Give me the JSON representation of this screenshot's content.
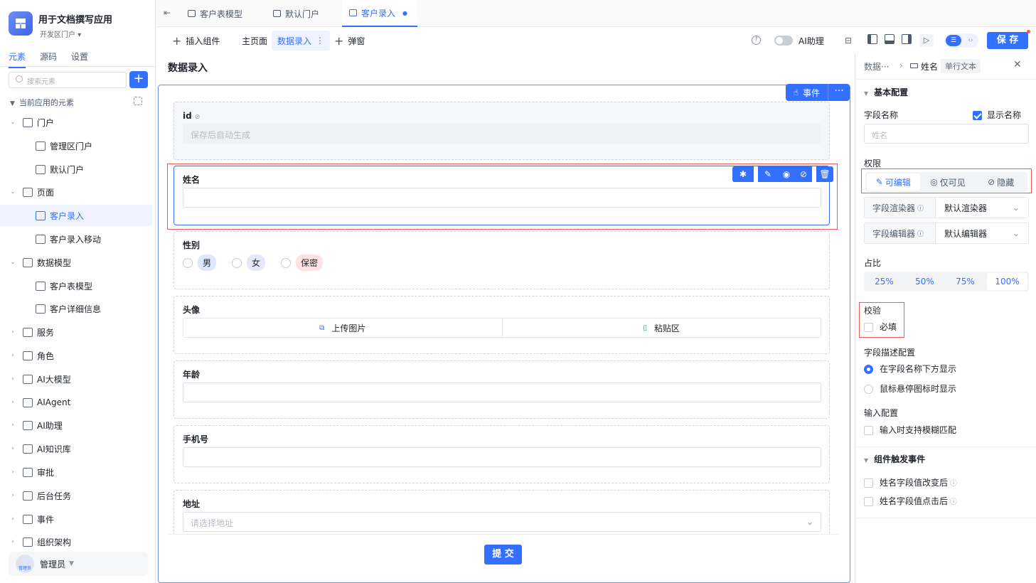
{
  "app": {
    "title": "用于文档撰写应用",
    "subtitle": "开发区门户 ▾"
  },
  "left_tabs": [
    "元素",
    "源码",
    "设置"
  ],
  "search": {
    "placeholder": "搜索元素"
  },
  "tree": {
    "header": "当前应用的元素",
    "items": [
      {
        "label": "门户",
        "level": 0,
        "arrow": "⌄"
      },
      {
        "label": "管理区门户",
        "level": 1
      },
      {
        "label": "默认门户",
        "level": 1
      },
      {
        "label": "页面",
        "level": 0,
        "arrow": "⌄"
      },
      {
        "label": "客户录入",
        "level": 1,
        "selected": true
      },
      {
        "label": "客户录入移动",
        "level": 1
      },
      {
        "label": "数据模型",
        "level": 0,
        "arrow": "⌄"
      },
      {
        "label": "客户表模型",
        "level": 1
      },
      {
        "label": "客户详细信息",
        "level": 1
      },
      {
        "label": "服务",
        "level": 0,
        "arrow": "›"
      },
      {
        "label": "角色",
        "level": 0,
        "arrow": "›"
      },
      {
        "label": "AI大模型",
        "level": 0,
        "arrow": "›"
      },
      {
        "label": "AIAgent",
        "level": 0,
        "arrow": "›"
      },
      {
        "label": "AI助理",
        "level": 0,
        "arrow": "›"
      },
      {
        "label": "AI知识库",
        "level": 0,
        "arrow": "›"
      },
      {
        "label": "审批",
        "level": 0,
        "arrow": "›"
      },
      {
        "label": "后台任务",
        "level": 0,
        "arrow": "›"
      },
      {
        "label": "事件",
        "level": 0,
        "arrow": "›"
      },
      {
        "label": "组织架构",
        "level": 0,
        "arrow": "›"
      }
    ]
  },
  "user": {
    "name": "管理员",
    "avatar_text": "管理员"
  },
  "top_tabs": [
    {
      "label": "客户表模型"
    },
    {
      "label": "默认门户"
    },
    {
      "label": "客户录入",
      "active": true,
      "dot": "●"
    }
  ],
  "toolbar": {
    "insert": "插入组件",
    "main_page": "主页面",
    "data_entry": "数据录入",
    "popup": "弹窗",
    "ai_assist": "AI助理",
    "save": "保 存"
  },
  "canvas": {
    "page_title": "数据录入",
    "event_btn": "事件",
    "more_btn": "···",
    "submit": "提 交",
    "fields": {
      "id": {
        "label": "id",
        "placeholder": "保存后自动生成"
      },
      "name": {
        "label": "姓名"
      },
      "gender": {
        "label": "性别",
        "options": [
          "男",
          "女",
          "保密"
        ]
      },
      "avatar": {
        "label": "头像",
        "upload": "上传图片",
        "paste": "粘贴区"
      },
      "age": {
        "label": "年龄"
      },
      "phone": {
        "label": "手机号"
      },
      "address": {
        "label": "地址",
        "placeholder": "请选择地址"
      }
    }
  },
  "right_panel": {
    "breadcrumb": "数据···",
    "field_name": "姓名",
    "field_type": "单行文本",
    "basic_config": "基本配置",
    "field_name_label": "字段名称",
    "show_name": "显示名称",
    "field_name_placeholder": "姓名",
    "permission": "权限",
    "perm_options": [
      "可编辑",
      "仅可见",
      "隐藏"
    ],
    "renderer_label": "字段渲染器",
    "renderer_value": "默认渲染器",
    "editor_label": "字段编辑器",
    "editor_value": "默认编辑器",
    "ratio": "占比",
    "ratio_options": [
      "25%",
      "50%",
      "75%",
      "100%"
    ],
    "validation": "校验",
    "required": "必填",
    "desc_config": "字段描述配置",
    "desc_opt1": "在字段名称下方显示",
    "desc_opt2": "鼠标悬停图标时显示",
    "input_config": "输入配置",
    "fuzzy": "输入时支持模糊匹配",
    "events": "组件触发事件",
    "event1": "姓名字段值改变后",
    "event2": "姓名字段值点击后"
  },
  "colors": {
    "accent": "#3370ff",
    "highlight": "#f05a5a"
  }
}
